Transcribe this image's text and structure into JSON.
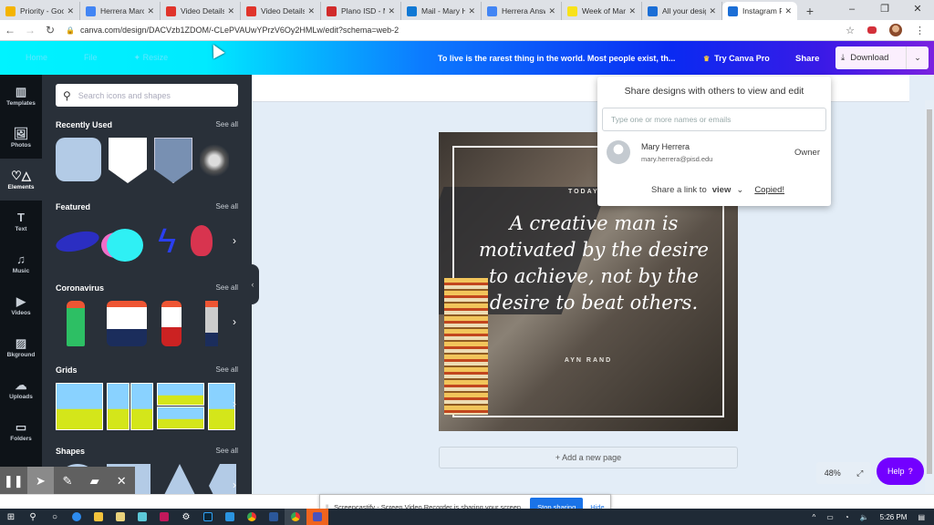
{
  "browser": {
    "tabs": [
      {
        "label": "Priority - Goo",
        "icon": "google-drive-icon",
        "color": "#f4b400"
      },
      {
        "label": "Herrera Marc",
        "icon": "google-docs-icon",
        "color": "#4285f4"
      },
      {
        "label": "Video Details",
        "icon": "video-icon",
        "color": "#e0342b"
      },
      {
        "label": "Video Details",
        "icon": "video-icon",
        "color": "#e0342b"
      },
      {
        "label": "Plano ISD - M",
        "icon": "plano-isd-icon",
        "color": "#d12b2b"
      },
      {
        "label": "Mail - Mary H",
        "icon": "outlook-icon",
        "color": "#0f78d4"
      },
      {
        "label": "Herrera Answ",
        "icon": "google-docs-icon",
        "color": "#4285f4"
      },
      {
        "label": "Week of Mar",
        "icon": "bitmoji-icon",
        "color": "#f8e21a"
      },
      {
        "label": "All your desig",
        "icon": "canva-icon",
        "color": "#1b6ed6"
      },
      {
        "label": "Instagram Po",
        "icon": "canva-icon",
        "color": "#1b6ed6",
        "active": true
      }
    ],
    "new_tab": "+",
    "window_controls": [
      "–",
      "❐",
      "✕"
    ],
    "url": "canva.com/design/DACVzb1ZDOM/-CLePVAUwYPrzV6Oy2HMLw/edit?schema=web-2"
  },
  "header": {
    "menu": [
      "Home",
      "File",
      "✦ Resize"
    ],
    "doc_title": "To live is the rarest thing in the world. Most people exist, th...",
    "try_pro": "Try Canva Pro",
    "share": "Share",
    "download": "Download"
  },
  "rail": [
    {
      "label": "Templates",
      "icon": "▥"
    },
    {
      "label": "Photos",
      "icon": "🖼"
    },
    {
      "label": "Elements",
      "icon": "♡△",
      "active": true
    },
    {
      "label": "Text",
      "icon": "T"
    },
    {
      "label": "Music",
      "icon": "♫"
    },
    {
      "label": "Videos",
      "icon": "▶"
    },
    {
      "label": "Bkground",
      "icon": "▨"
    },
    {
      "label": "Uploads",
      "icon": "☁"
    },
    {
      "label": "Folders",
      "icon": "▭"
    }
  ],
  "panel": {
    "search_placeholder": "Search icons and shapes",
    "see_all": "See all",
    "sections": [
      "Recently Used",
      "Featured",
      "Coronavirus",
      "Grids",
      "Shapes"
    ]
  },
  "share_popup": {
    "title": "Share designs with others to view and edit",
    "input_placeholder": "Type one or more names or emails",
    "user_name": "Mary Herrera",
    "user_email": "mary.herrera@pisd.edu",
    "role": "Owner",
    "link_prefix": "Share a link to",
    "link_mode": "view",
    "copied": "Copied!"
  },
  "design": {
    "kicker": "TODAY'S",
    "quote": "A creative man is motivated by the desire to achieve, not by the desire to beat others.",
    "author": "AYN RAND"
  },
  "canvas": {
    "add_page": "+ Add a new page",
    "zoom": "48%",
    "help": "Help",
    "help_mark": "?"
  },
  "screencastify": {
    "message": "Screencastify - Screen Video Recorder is sharing your screen.",
    "stop": "Stop sharing",
    "hide": "Hide"
  },
  "taskbar": {
    "time": "5:26 PM"
  }
}
